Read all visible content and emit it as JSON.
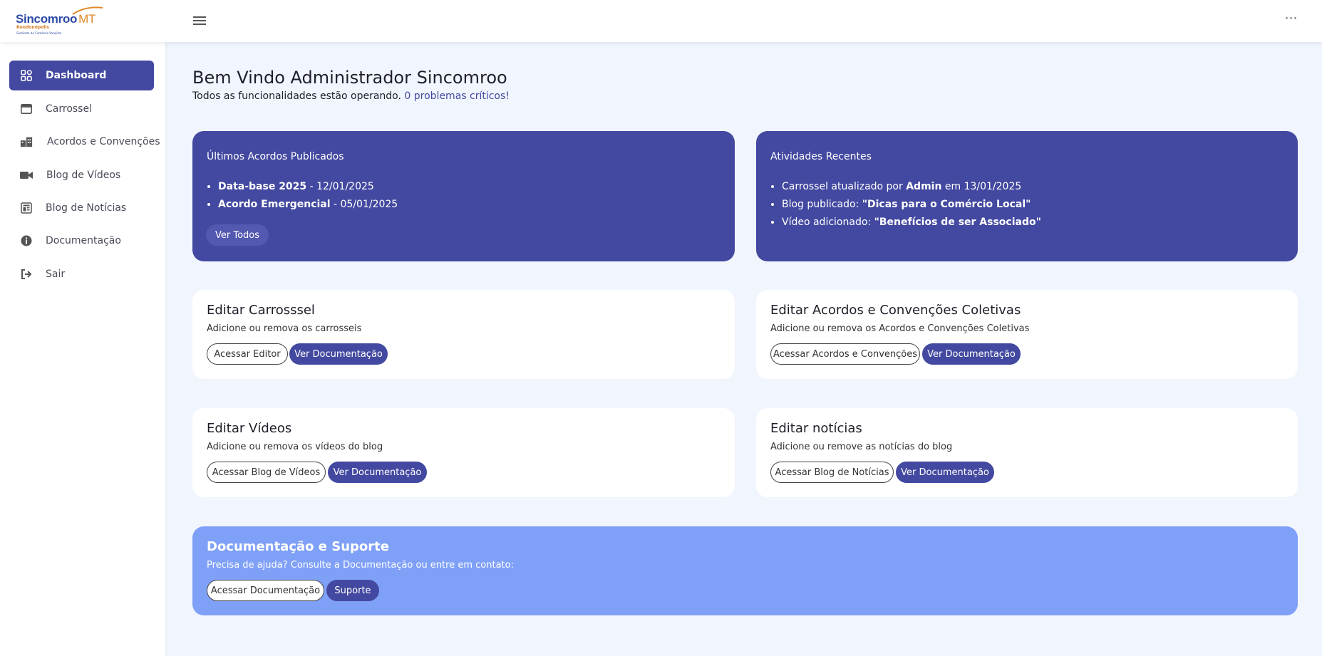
{
  "header": {
    "logo_brand": "Sincomroo",
    "logo_mt": "MT",
    "logo_city": "Rondonópolis",
    "logo_tagline": "Sindicato do Comércio Varejista"
  },
  "sidebar": {
    "items": [
      {
        "label": "Dashboard",
        "icon": "dashboard-grid-icon",
        "active": true
      },
      {
        "label": "Carrossel",
        "icon": "carousel-icon"
      },
      {
        "label": "Acordos e Convenções",
        "icon": "buildings-icon"
      },
      {
        "label": "Blog de Vídeos",
        "icon": "video-camera-icon"
      },
      {
        "label": "Blog de Notícias",
        "icon": "newspaper-icon"
      },
      {
        "label": "Documentação",
        "icon": "info-icon"
      },
      {
        "label": "Sair",
        "icon": "logout-icon"
      }
    ]
  },
  "welcome": {
    "title": "Bem Vindo Administrador Sincomroo",
    "status": "Todos as funcionalidades estão operando.",
    "critical": "0 problemas críticos!"
  },
  "latest_agreements": {
    "title": "Últimos Acordos Publicados",
    "items": [
      {
        "name": "Data-base 2025",
        "date": " - 12/01/2025"
      },
      {
        "name": "Acordo Emergencial",
        "date": " - 05/01/2025"
      }
    ],
    "button": "Ver Todos"
  },
  "recent_activity": {
    "title": "Atividades Recentes",
    "items": [
      {
        "pre": "Carrossel atualizado por ",
        "bold": "Admin",
        "post": " em 13/01/2025"
      },
      {
        "pre": "Blog publicado: ",
        "bold": "\"Dicas para o Comércio Local\"",
        "post": ""
      },
      {
        "pre": "Vídeo adicionado: ",
        "bold": "\"Benefícios de ser Associado\"",
        "post": ""
      }
    ]
  },
  "cards": {
    "carousel": {
      "title": "Editar Carrosssel",
      "desc": "Adicione ou remova os carrosseis",
      "btn1": "Acessar Editor",
      "btn2": "Ver Documentação"
    },
    "agreements": {
      "title": "Editar Acordos e Convenções Coletivas",
      "desc": "Adicione ou remova os Acordos e Convenções Coletivas",
      "btn1": "Acessar Acordos e Convenções",
      "btn2": "Ver Documentação"
    },
    "videos": {
      "title": "Editar Vídeos",
      "desc": "Adicione ou remova os vídeos do blog",
      "btn1": "Acessar Blog de Vídeos",
      "btn2": "Ver Documentação"
    },
    "news": {
      "title": "Editar notícias",
      "desc": "Adicione ou remove as notícias do blog",
      "btn1": "Acessar Blog de Notícias",
      "btn2": "Ver Documentação"
    }
  },
  "support": {
    "title": "Documentação e Suporte",
    "desc": "Precisa de ajuda? Consulte a Documentação ou entre em contato:",
    "btn1": "Acessar Documentação",
    "btn2": "Suporte"
  },
  "colors": {
    "primary": "#4349a0",
    "support_bg": "#7fa0f7",
    "page_bg": "#f1f5fd",
    "logo_orange": "#e08a2a",
    "logo_blue": "#2b4aa6"
  }
}
